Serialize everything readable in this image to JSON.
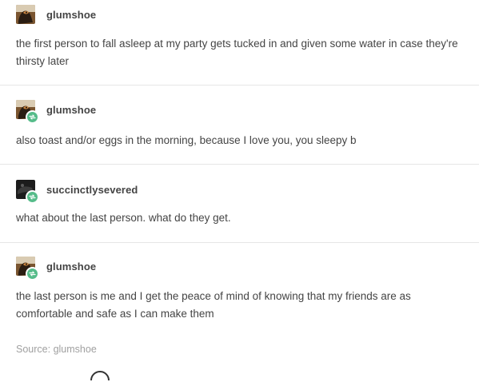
{
  "posts": [
    {
      "username": "glumshoe",
      "avatar": "dog-photo-avatar",
      "reblog_badge": false,
      "text": "the first person to fall asleep at my party gets tucked in and given some water in case they're thirsty later"
    },
    {
      "username": "glumshoe",
      "avatar": "dog-photo-avatar",
      "reblog_badge": true,
      "text": "also toast and/or eggs in the morning, because I love you, you sleepy b"
    },
    {
      "username": "succinctlysevered",
      "avatar": "dark-photo-avatar",
      "reblog_badge": true,
      "text": "what about the last person. what do they get."
    },
    {
      "username": "glumshoe",
      "avatar": "dog-photo-avatar",
      "reblog_badge": true,
      "text": "the last person is me and I get the peace of mind of knowing that my friends are as comfortable and safe as I can make them"
    }
  ],
  "source": {
    "label": "Source:",
    "username": "glumshoe"
  },
  "colors": {
    "text": "#444444",
    "divider": "#e6e6e6",
    "source": "#a0a0a0",
    "reblog_badge": "#56bc8a"
  }
}
